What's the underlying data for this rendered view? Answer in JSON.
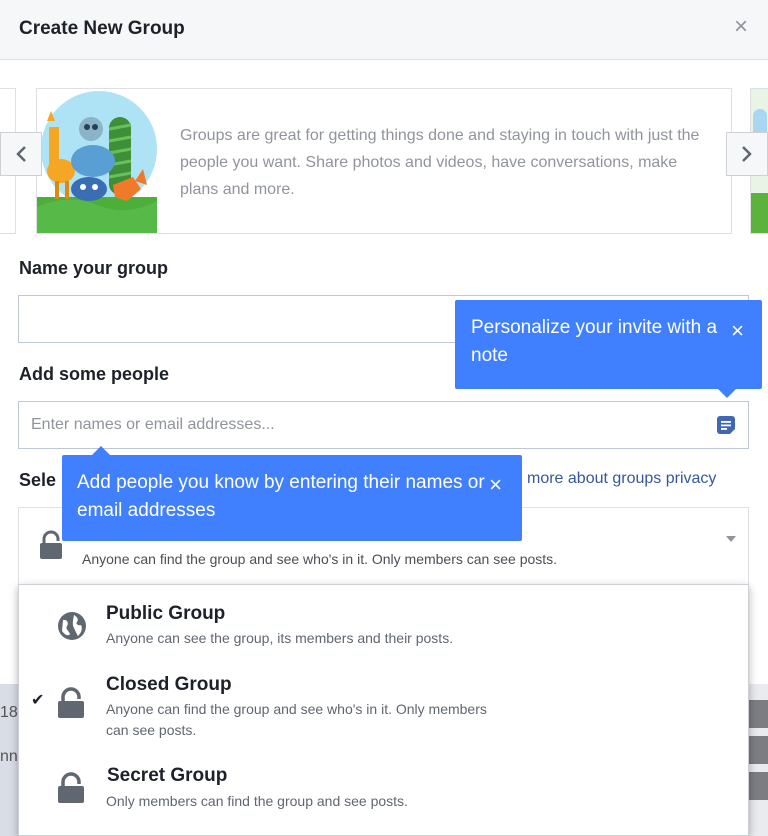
{
  "dialog": {
    "title": "Create New Group",
    "close_label": "×"
  },
  "carousel": {
    "text": "Groups are great for getting things done and staying in touch with just the people you want. Share photos and videos, have conversations, make plans and more."
  },
  "name_section": {
    "label": "Name your group",
    "value": ""
  },
  "people_section": {
    "label": "Add some people",
    "placeholder": "Enter names or email addresses..."
  },
  "privacy_section": {
    "label_partial": "Sele",
    "link_partial": "more about groups privacy",
    "selected_description": "Anyone can find the group and see who's in it. Only members can see posts."
  },
  "tooltips": {
    "invite_note": "Personalize your invite with a note",
    "add_people": "Add people you know by entering their names or email addresses",
    "close_label": "×"
  },
  "privacy_options": [
    {
      "name": "Public Group",
      "description": "Anyone can see the group, its members and their posts.",
      "icon": "globe-icon",
      "selected": false
    },
    {
      "name": "Closed Group",
      "description": "Anyone can find the group and see who's in it. Only members can see posts.",
      "icon": "lock-icon",
      "selected": true
    },
    {
      "name": "Secret Group",
      "description": "Only members can find the group and see posts.",
      "icon": "lock-icon",
      "selected": false
    }
  ],
  "background_fragments": {
    "left_top": "18",
    "left_bottom": "nn"
  },
  "colors": {
    "tooltip": "#4080ff",
    "link": "#365899",
    "header_bg": "#f6f7f9"
  }
}
